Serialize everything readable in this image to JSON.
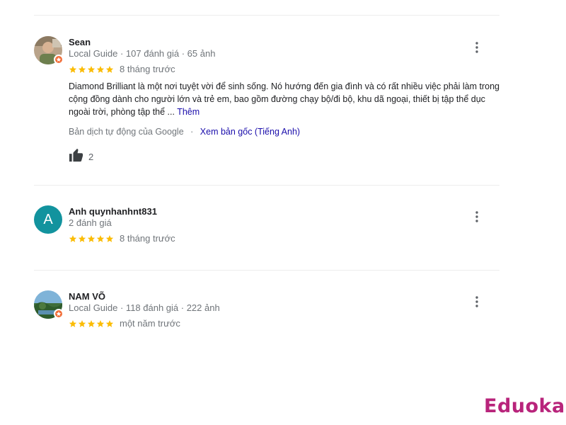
{
  "reviews": [
    {
      "name": "Sean",
      "meta": "Local Guide · 107 đánh giá · 65 ảnh",
      "stars": 5,
      "time": "8 tháng trước",
      "text": "Diamond Brilliant là một nơi tuyệt vời để sinh sống. Nó hướng đến gia đình và có rất nhiều việc phải làm trong cộng đồng dành cho người lớn và trẻ em, bao gồm đường chạy bộ/đi bộ, khu dã ngoại, thiết bị tập thể dục ngoài trời, phòng tập thể ...",
      "more": "Thêm",
      "translation_note": "Bản dịch tự động của Google",
      "translation_sep": "·",
      "original_link": "Xem bản gốc (Tiếng Anh)",
      "likes": "2"
    },
    {
      "name": "Anh quynhanhnt831",
      "avatar_letter": "A",
      "meta": "2 đánh giá",
      "stars": 5,
      "time": "8 tháng trước"
    },
    {
      "name": "NAM VÕ",
      "meta": "Local Guide · 118 đánh giá · 222 ảnh",
      "stars": 5,
      "time": "một năm trước"
    }
  ],
  "brand": {
    "logo_text": "Eduoka"
  },
  "colors": {
    "star": "#fbbc04",
    "link": "#1a0dab",
    "avatar_letter_bg": "#12939e",
    "guide_badge": "#f26f3a",
    "brand": "#b8247b"
  },
  "icons": [
    "star-icon",
    "more-vert-icon",
    "thumb-up-icon",
    "local-guide-badge-icon"
  ]
}
